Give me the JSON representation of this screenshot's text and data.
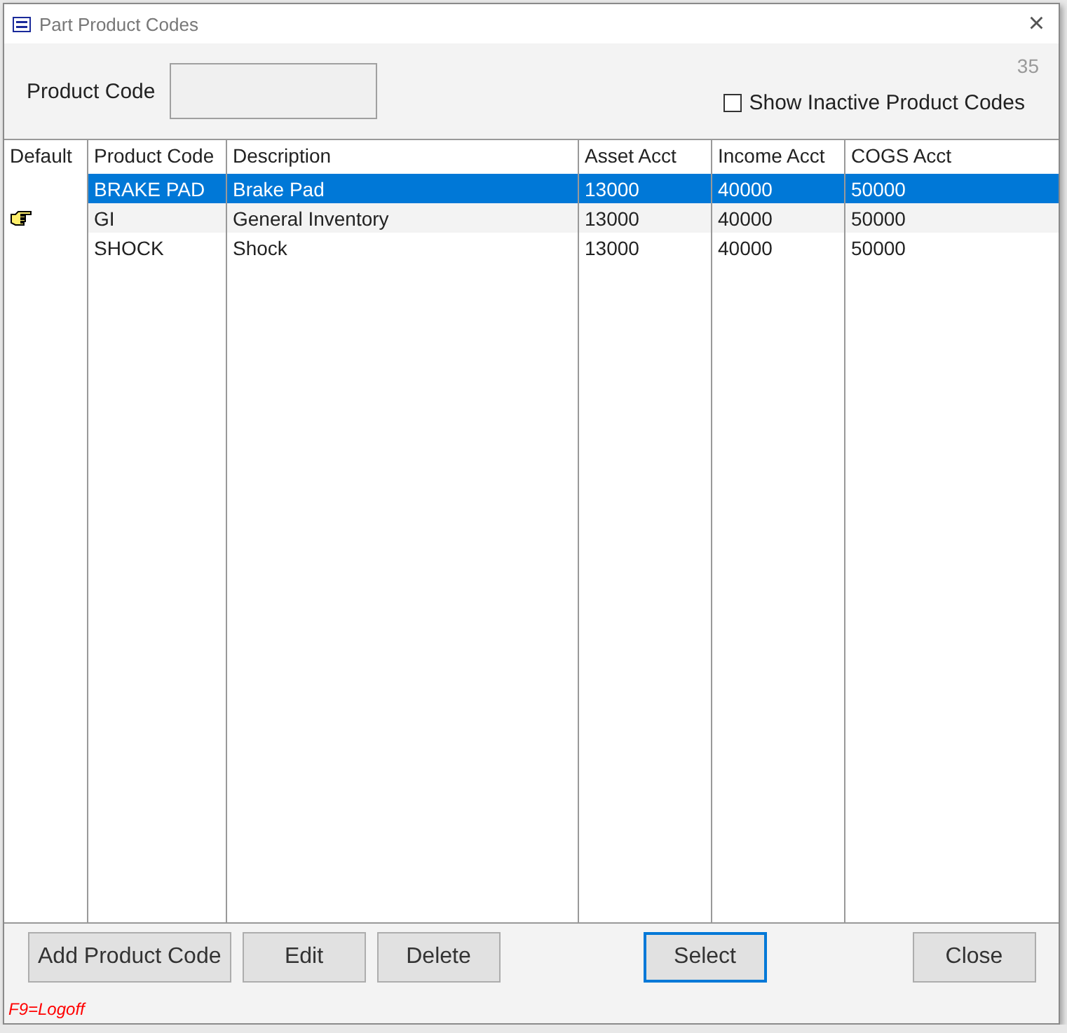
{
  "window": {
    "title": "Part Product Codes",
    "close": "×"
  },
  "filter": {
    "label": "Product Code",
    "count": "35",
    "show_inactive": {
      "label": "Show Inactive Product Codes",
      "checked": false
    }
  },
  "table": {
    "columns": [
      "Default",
      "Product Code",
      "Description",
      "Asset  Acct",
      "Income Acct",
      "COGS Acct"
    ],
    "rows": [
      {
        "default": false,
        "selected": true,
        "cells": [
          "",
          "BRAKE PAD",
          "Brake Pad",
          "13000",
          "40000",
          "50000"
        ]
      },
      {
        "default": true,
        "selected": false,
        "cells": [
          "",
          "GI",
          "General Inventory",
          "13000",
          "40000",
          "50000"
        ]
      },
      {
        "default": false,
        "selected": false,
        "cells": [
          "",
          "SHOCK",
          "Shock",
          "13000",
          "40000",
          "50000"
        ]
      }
    ]
  },
  "buttons": [
    {
      "label": "Add Product Code",
      "focused": false
    },
    {
      "label": "Edit",
      "focused": false
    },
    {
      "label": "Delete",
      "focused": false
    },
    {
      "label": "Select",
      "focused": true
    },
    {
      "label": "Close",
      "focused": false
    }
  ],
  "status": "F9=Logoff"
}
